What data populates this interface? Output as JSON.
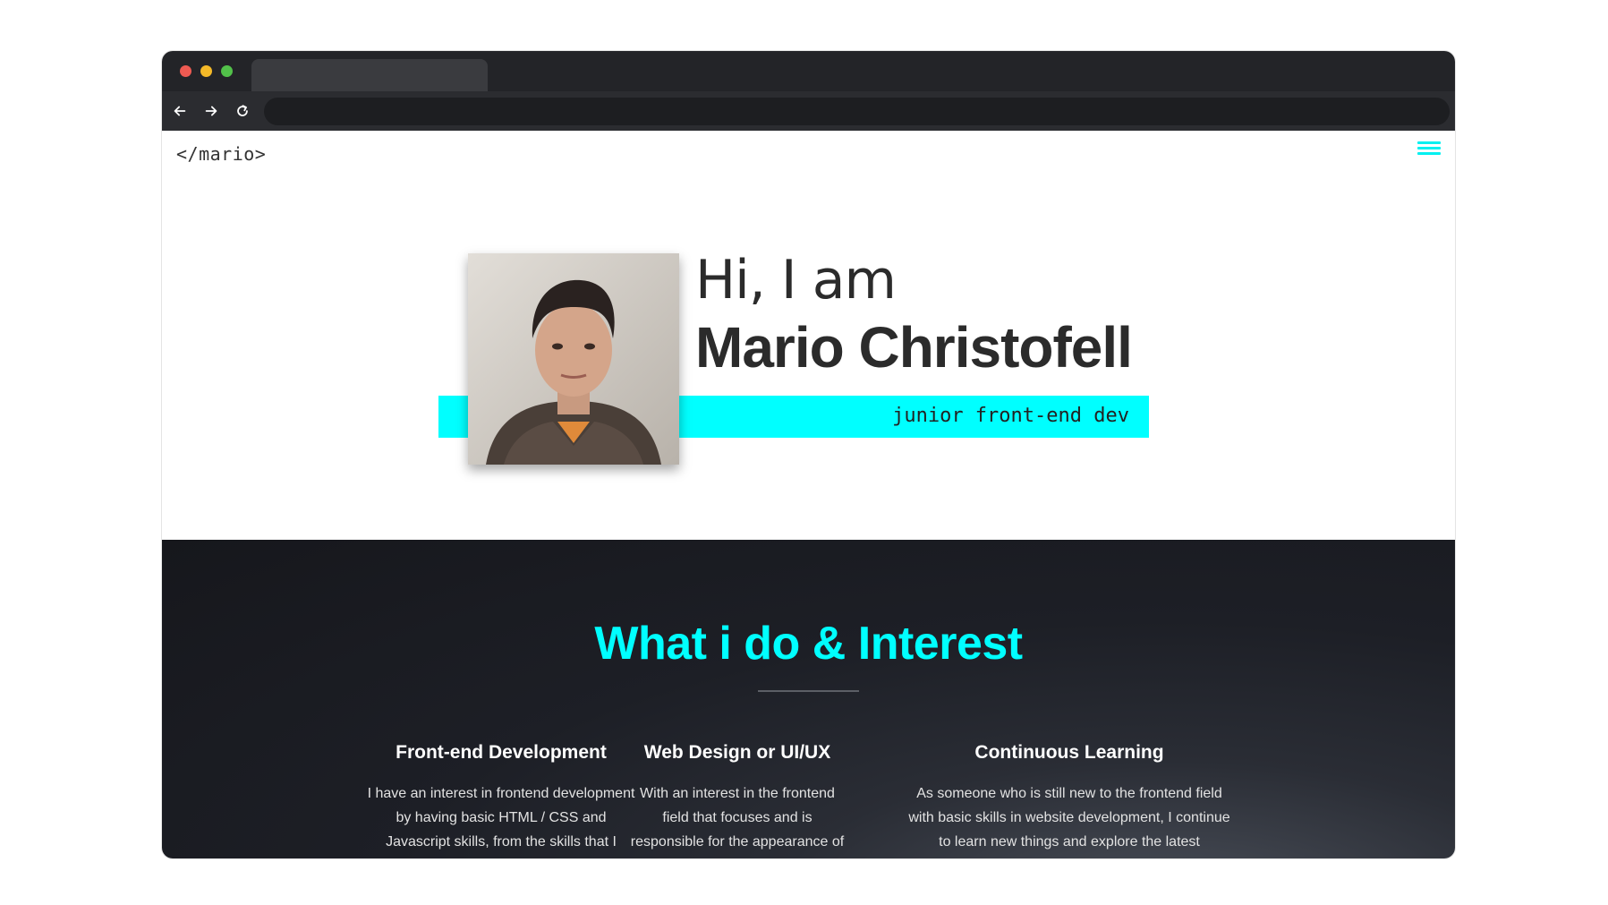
{
  "site": {
    "logo": "</mario>"
  },
  "hero": {
    "greeting": "Hi, I am",
    "name": "Mario Christofell",
    "role": "junior front-end dev"
  },
  "interests": {
    "title": "What i do & Interest",
    "items": [
      {
        "title": "Front-end Development",
        "text": "I have an interest in frontend development by having basic HTML / CSS and Javascript skills, from the skills that I"
      },
      {
        "title": "Web Design or UI/UX",
        "text": "With an interest in the frontend field that focuses and is responsible for the appearance of"
      },
      {
        "title": "Continuous Learning",
        "text": "As someone who is still new to the frontend field with basic skills in website development, I continue to learn new things and explore the latest"
      }
    ]
  },
  "colors": {
    "accent": "#00ffff",
    "dark_bg": "#1d1f26",
    "text_dark": "#2b2b2b"
  }
}
